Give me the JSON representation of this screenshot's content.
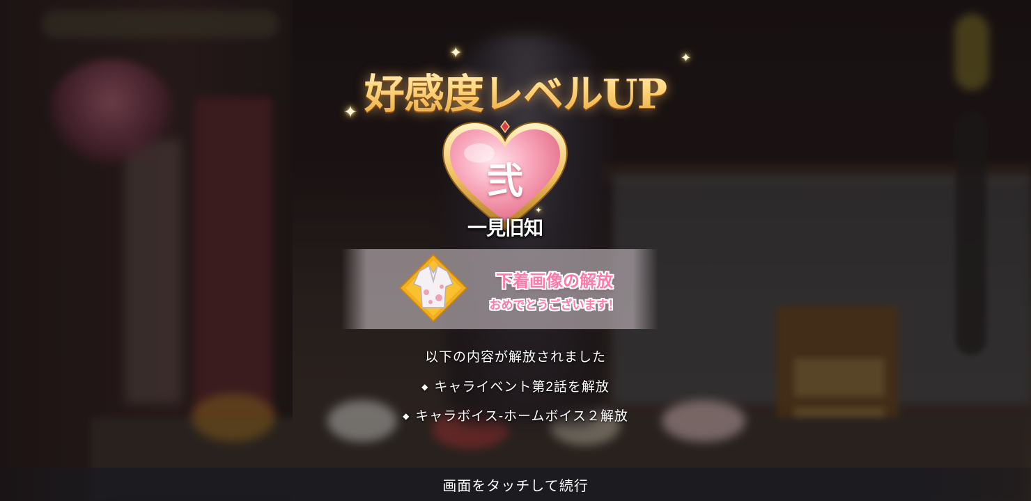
{
  "title": "好感度レベルUP",
  "heart_badge": {
    "kanji": "弐",
    "level_name": "一見旧知"
  },
  "reward_banner": {
    "item_icon": "kimono-outfit-icon",
    "title": "下着画像の解放",
    "subtitle": "おめでとうございます！"
  },
  "unlocked": {
    "heading": "以下の内容が解放されました",
    "bullet": "◆",
    "items": [
      "キャライベント第2話を解放",
      "キャラボイス-ホームボイス２解放"
    ]
  },
  "footer": {
    "continue_text": "画面をタッチして続行"
  },
  "colors": {
    "title_gold": "#ffd880",
    "heart_pink": "#f4a0b4",
    "banner_text_pink": "#ff7aa8",
    "bottom_bar": "#1a1a20"
  }
}
